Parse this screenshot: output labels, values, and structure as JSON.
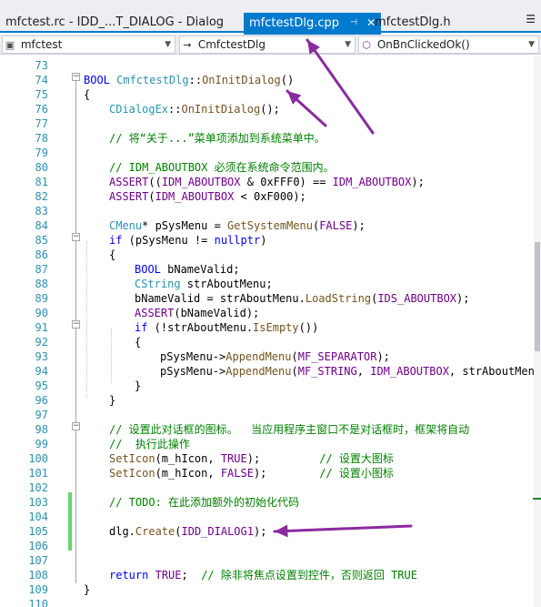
{
  "tabs": [
    {
      "label": "mfctest.rc - IDD_...T_DIALOG - Dialog",
      "active": false
    },
    {
      "label": "mfctestDlg.cpp",
      "active": true
    },
    {
      "label": "mfctestDlg.h",
      "active": false
    }
  ],
  "tab_icons": {
    "pin": "pin-icon",
    "close": "close-icon",
    "dropdown": "chevron-down-icon"
  },
  "nav": {
    "project": "mfctest",
    "class": "CmfctestDlg",
    "member": "OnBnClickedOk()"
  },
  "colors": {
    "accent": "#007acc",
    "keyword": "#0000ff",
    "comment": "#008000",
    "type": "#2b91af",
    "macro": "#6f008a",
    "function": "#74531f",
    "annotation_arrow": "#8b2a9e"
  },
  "lines": [
    {
      "n": "73",
      "segs": []
    },
    {
      "n": "74",
      "segs": [
        {
          "c": "kw",
          "t": "BOOL "
        },
        {
          "c": "ty",
          "t": "CmfctestDlg"
        },
        {
          "c": "nm",
          "t": "::"
        },
        {
          "c": "fn",
          "t": "OnInitDialog"
        },
        {
          "c": "nm",
          "t": "()"
        }
      ],
      "indent": 0
    },
    {
      "n": "75",
      "segs": [
        {
          "c": "nm",
          "t": "{"
        }
      ],
      "indent": 0
    },
    {
      "n": "76",
      "segs": [
        {
          "c": "ty",
          "t": "CDialogEx"
        },
        {
          "c": "nm",
          "t": "::"
        },
        {
          "c": "fn",
          "t": "OnInitDialog"
        },
        {
          "c": "nm",
          "t": "();"
        }
      ],
      "indent": 1
    },
    {
      "n": "77",
      "segs": []
    },
    {
      "n": "78",
      "segs": [
        {
          "c": "cm",
          "t": "// 将“关于...”菜单项添加到系统菜单中。"
        }
      ],
      "indent": 1
    },
    {
      "n": "79",
      "segs": []
    },
    {
      "n": "80",
      "segs": [
        {
          "c": "cm",
          "t": "// IDM_ABOUTBOX 必须在系统命令范围内。"
        }
      ],
      "indent": 1
    },
    {
      "n": "81",
      "segs": [
        {
          "c": "mc",
          "t": "ASSERT"
        },
        {
          "c": "nm",
          "t": "(("
        },
        {
          "c": "mc",
          "t": "IDM_ABOUTBOX"
        },
        {
          "c": "nm",
          "t": " & 0xFFF0) == "
        },
        {
          "c": "mc",
          "t": "IDM_ABOUTBOX"
        },
        {
          "c": "nm",
          "t": ");"
        }
      ],
      "indent": 1
    },
    {
      "n": "82",
      "segs": [
        {
          "c": "mc",
          "t": "ASSERT"
        },
        {
          "c": "nm",
          "t": "("
        },
        {
          "c": "mc",
          "t": "IDM_ABOUTBOX"
        },
        {
          "c": "nm",
          "t": " < 0xF000);"
        }
      ],
      "indent": 1
    },
    {
      "n": "83",
      "segs": []
    },
    {
      "n": "84",
      "segs": [
        {
          "c": "ty",
          "t": "CMenu"
        },
        {
          "c": "nm",
          "t": "* pSysMenu = "
        },
        {
          "c": "fn",
          "t": "GetSystemMenu"
        },
        {
          "c": "nm",
          "t": "("
        },
        {
          "c": "mc",
          "t": "FALSE"
        },
        {
          "c": "nm",
          "t": ");"
        }
      ],
      "indent": 1
    },
    {
      "n": "85",
      "segs": [
        {
          "c": "kw",
          "t": "if"
        },
        {
          "c": "nm",
          "t": " (pSysMenu != "
        },
        {
          "c": "kw",
          "t": "nullptr"
        },
        {
          "c": "nm",
          "t": ")"
        }
      ],
      "indent": 1
    },
    {
      "n": "86",
      "segs": [
        {
          "c": "nm",
          "t": "{"
        }
      ],
      "indent": 1
    },
    {
      "n": "87",
      "segs": [
        {
          "c": "kw",
          "t": "BOOL"
        },
        {
          "c": "nm",
          "t": " bNameValid;"
        }
      ],
      "indent": 2
    },
    {
      "n": "88",
      "segs": [
        {
          "c": "ty",
          "t": "CString"
        },
        {
          "c": "nm",
          "t": " strAboutMenu;"
        }
      ],
      "indent": 2
    },
    {
      "n": "89",
      "segs": [
        {
          "c": "nm",
          "t": "bNameValid = strAboutMenu."
        },
        {
          "c": "fn",
          "t": "LoadString"
        },
        {
          "c": "nm",
          "t": "("
        },
        {
          "c": "mc",
          "t": "IDS_ABOUTBOX"
        },
        {
          "c": "nm",
          "t": ");"
        }
      ],
      "indent": 2
    },
    {
      "n": "90",
      "segs": [
        {
          "c": "mc",
          "t": "ASSERT"
        },
        {
          "c": "nm",
          "t": "(bNameValid);"
        }
      ],
      "indent": 2
    },
    {
      "n": "91",
      "segs": [
        {
          "c": "kw",
          "t": "if"
        },
        {
          "c": "nm",
          "t": " (!strAboutMenu."
        },
        {
          "c": "fn",
          "t": "IsEmpty"
        },
        {
          "c": "nm",
          "t": "())"
        }
      ],
      "indent": 2
    },
    {
      "n": "92",
      "segs": [
        {
          "c": "nm",
          "t": "{"
        }
      ],
      "indent": 2
    },
    {
      "n": "93",
      "segs": [
        {
          "c": "nm",
          "t": "pSysMenu->"
        },
        {
          "c": "fn",
          "t": "AppendMenu"
        },
        {
          "c": "nm",
          "t": "("
        },
        {
          "c": "mc",
          "t": "MF_SEPARATOR"
        },
        {
          "c": "nm",
          "t": ");"
        }
      ],
      "indent": 3
    },
    {
      "n": "94",
      "segs": [
        {
          "c": "nm",
          "t": "pSysMenu->"
        },
        {
          "c": "fn",
          "t": "AppendMenu"
        },
        {
          "c": "nm",
          "t": "("
        },
        {
          "c": "mc",
          "t": "MF_STRING"
        },
        {
          "c": "nm",
          "t": ", "
        },
        {
          "c": "mc",
          "t": "IDM_ABOUTBOX"
        },
        {
          "c": "nm",
          "t": ", strAboutMenu);"
        }
      ],
      "indent": 3
    },
    {
      "n": "95",
      "segs": [
        {
          "c": "nm",
          "t": "}"
        }
      ],
      "indent": 2
    },
    {
      "n": "96",
      "segs": [
        {
          "c": "nm",
          "t": "}"
        }
      ],
      "indent": 1
    },
    {
      "n": "97",
      "segs": []
    },
    {
      "n": "98",
      "segs": [
        {
          "c": "cm",
          "t": "// 设置此对话框的图标。  当应用程序主窗口不是对话框时，框架将自动"
        }
      ],
      "indent": 1
    },
    {
      "n": "99",
      "segs": [
        {
          "c": "cm",
          "t": "//  执行此操作"
        }
      ],
      "indent": 1
    },
    {
      "n": "100",
      "segs": [
        {
          "c": "fn",
          "t": "SetIcon"
        },
        {
          "c": "nm",
          "t": "(m_hIcon, "
        },
        {
          "c": "mc",
          "t": "TRUE"
        },
        {
          "c": "nm",
          "t": ");         "
        },
        {
          "c": "cm",
          "t": "// 设置大图标"
        }
      ],
      "indent": 1
    },
    {
      "n": "101",
      "segs": [
        {
          "c": "fn",
          "t": "SetIcon"
        },
        {
          "c": "nm",
          "t": "(m_hIcon, "
        },
        {
          "c": "mc",
          "t": "FALSE"
        },
        {
          "c": "nm",
          "t": ");        "
        },
        {
          "c": "cm",
          "t": "// 设置小图标"
        }
      ],
      "indent": 1
    },
    {
      "n": "102",
      "segs": []
    },
    {
      "n": "103",
      "segs": [
        {
          "c": "cm",
          "t": "// TODO: 在此添加额外的初始化代码"
        }
      ],
      "indent": 1
    },
    {
      "n": "104",
      "segs": []
    },
    {
      "n": "105",
      "segs": [
        {
          "c": "nm",
          "t": "dlg."
        },
        {
          "c": "fn",
          "t": "Create"
        },
        {
          "c": "nm",
          "t": "("
        },
        {
          "c": "mc",
          "t": "IDD_DIALOG1"
        },
        {
          "c": "nm",
          "t": ");"
        }
      ],
      "indent": 1
    },
    {
      "n": "106",
      "segs": []
    },
    {
      "n": "107",
      "segs": []
    },
    {
      "n": "108",
      "segs": [
        {
          "c": "kw",
          "t": "return"
        },
        {
          "c": "nm",
          "t": " "
        },
        {
          "c": "mc",
          "t": "TRUE"
        },
        {
          "c": "nm",
          "t": ";  "
        },
        {
          "c": "cm",
          "t": "// 除非将焦点设置到控件，否则返回 TRUE"
        }
      ],
      "indent": 1
    },
    {
      "n": "109",
      "segs": [
        {
          "c": "nm",
          "t": "}"
        }
      ],
      "indent": 0
    },
    {
      "n": "110",
      "segs": []
    }
  ]
}
